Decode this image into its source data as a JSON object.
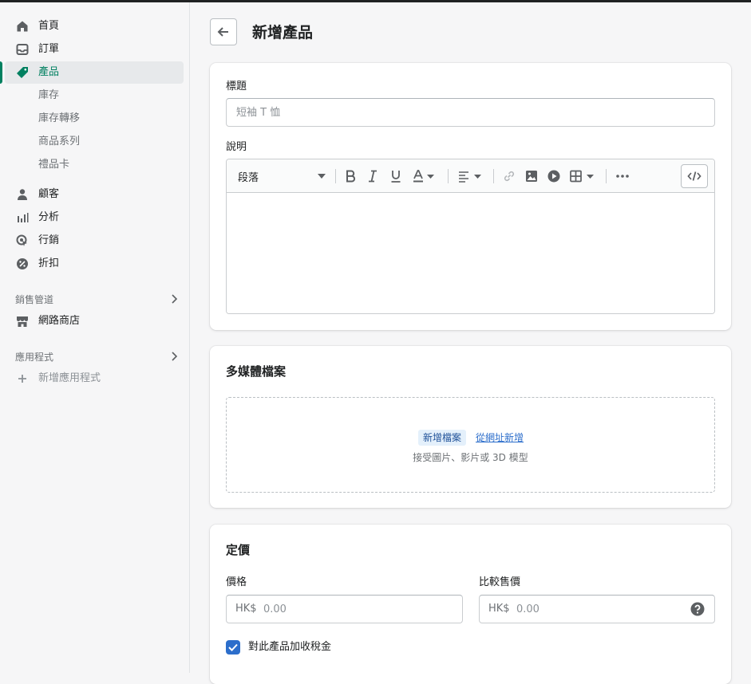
{
  "sidebar": {
    "items": [
      {
        "label": "首頁",
        "icon": "home-icon"
      },
      {
        "label": "訂單",
        "icon": "inbox-icon"
      },
      {
        "label": "產品",
        "icon": "tag-icon",
        "active": true
      },
      {
        "label": "顧客",
        "icon": "person-icon"
      },
      {
        "label": "分析",
        "icon": "bar-chart-icon"
      },
      {
        "label": "行銷",
        "icon": "target-icon"
      },
      {
        "label": "折扣",
        "icon": "discount-icon"
      }
    ],
    "sub_items": [
      "庫存",
      "庫存轉移",
      "商品系列",
      "禮品卡"
    ],
    "sales_channels": {
      "heading": "銷售管道",
      "online_store": "網路商店"
    },
    "apps": {
      "heading": "應用程式",
      "add_app": "新增應用程式"
    }
  },
  "page": {
    "title": "新增產品"
  },
  "product": {
    "title_label": "標題",
    "title_placeholder": "短袖 T 恤",
    "description_label": "說明",
    "paragraph_label": "段落"
  },
  "media": {
    "heading": "多媒體檔案",
    "add_file": "新增檔案",
    "add_from_url": "從網址新增",
    "accepts": "接受圖片、影片或 3D 模型"
  },
  "pricing": {
    "heading": "定價",
    "price_label": "價格",
    "compare_label": "比較售價",
    "currency_prefix": "HK$",
    "price_placeholder": "0.00",
    "compare_placeholder": "0.00",
    "charge_tax_label": "對此產品加收稅金",
    "charge_tax_checked": true
  },
  "colors": {
    "accent": "#008060",
    "checkbox": "#2c6ecb",
    "link": "#2c6ecb"
  }
}
